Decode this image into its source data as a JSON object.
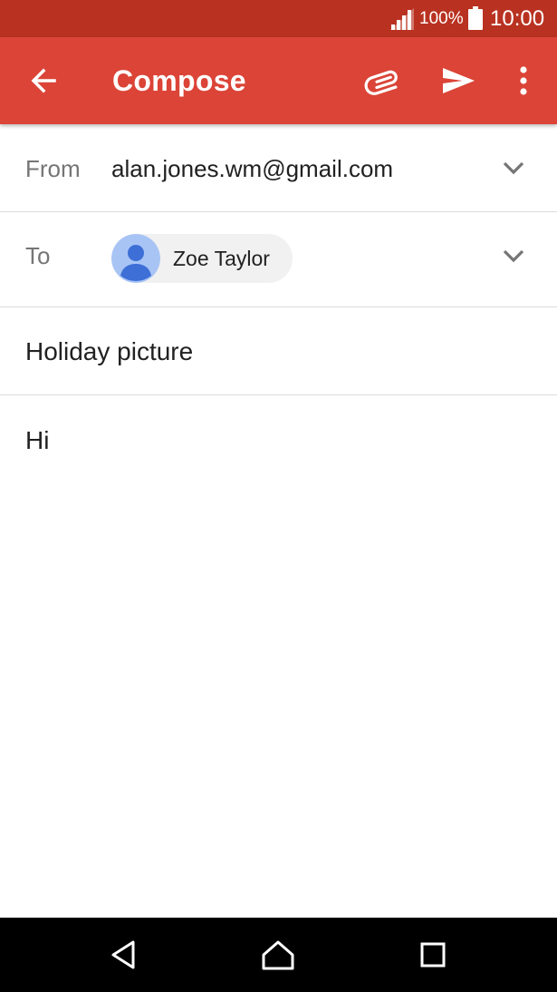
{
  "status_bar": {
    "battery_percent": "100%",
    "time": "10:00",
    "signal_icon": "cell-signal-icon",
    "battery_icon": "battery-full-icon"
  },
  "toolbar": {
    "title": "Compose",
    "back_icon": "arrow-back-icon",
    "attach_icon": "paperclip-icon",
    "send_icon": "send-icon",
    "more_icon": "more-vert-icon",
    "color": "#db4437"
  },
  "from": {
    "label": "From",
    "value": "alan.jones.wm@gmail.com"
  },
  "to": {
    "label": "To",
    "recipients": [
      {
        "name": "Zoe Taylor",
        "avatar_icon": "person-avatar-icon"
      }
    ]
  },
  "subject": {
    "value": "Holiday picture"
  },
  "body": {
    "value": "Hi"
  },
  "nav_bar": {
    "back_icon": "nav-back-icon",
    "home_icon": "nav-home-icon",
    "recents_icon": "nav-recents-icon"
  }
}
